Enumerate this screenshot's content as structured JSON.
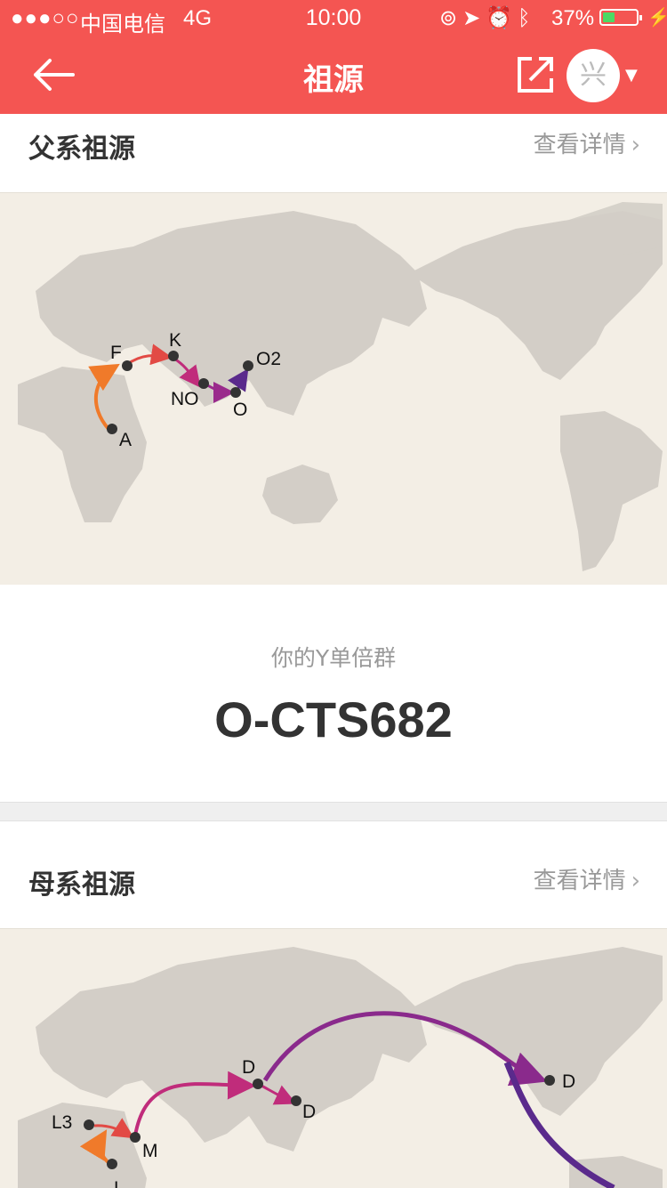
{
  "status_bar": {
    "signal": "●●●○○",
    "carrier": "中国电信",
    "network": "4G",
    "time": "10:00",
    "battery_percent": "37%",
    "battery_level": 0.37
  },
  "nav": {
    "title": "祖源",
    "avatar_char": "兴"
  },
  "paternal": {
    "title": "父系祖源",
    "more": "查看详情",
    "haplogroup_label": "你的Y单倍群",
    "haplogroup_value": "O-CTS682",
    "points": [
      "A",
      "F",
      "K",
      "NO",
      "O",
      "O2"
    ]
  },
  "maternal": {
    "title": "母系祖源",
    "more": "查看详情",
    "points": [
      "L3",
      "M",
      "D",
      "D",
      "D",
      "L"
    ]
  },
  "colors": {
    "brand": "#f45552",
    "map_bg": "#f3eee5",
    "land": "#d3cec7",
    "orange": "#f07a2a",
    "red": "#e24a45",
    "magenta": "#c02c7b",
    "purple": "#7a2a8c"
  }
}
